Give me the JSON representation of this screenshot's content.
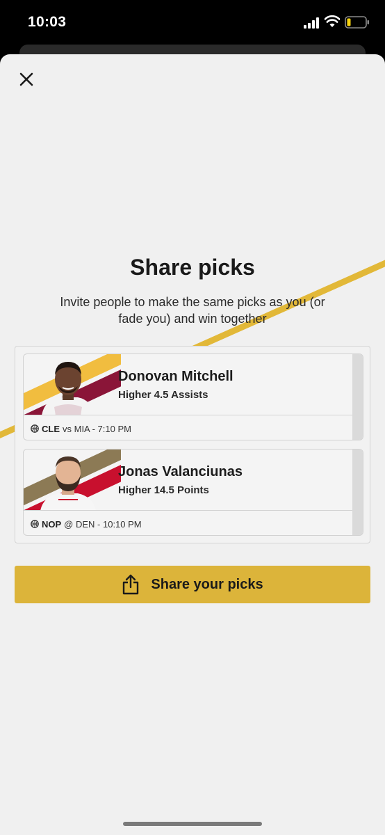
{
  "status_bar": {
    "time": "10:03"
  },
  "sheet": {
    "title": "Share picks",
    "subtitle": "Invite people to make the same picks as you (or fade you) and win together"
  },
  "picks": [
    {
      "player": "Donovan Mitchell",
      "line": "Higher 4.5 Assists",
      "team": "CLE",
      "matchup": "vs MIA - 7:10 PM",
      "team_colors": [
        "#f1bd3f",
        "#8a1538"
      ]
    },
    {
      "player": "Jonas Valanciunas",
      "line": "Higher 14.5 Points",
      "team": "NOP",
      "matchup": "@ DEN - 10:10 PM",
      "team_colors": [
        "#8c7a55",
        "#c8102e"
      ]
    }
  ],
  "share_button": {
    "label": "Share your picks"
  },
  "colors": {
    "accent": "#dcb43a",
    "background": "#f0f0f0"
  }
}
